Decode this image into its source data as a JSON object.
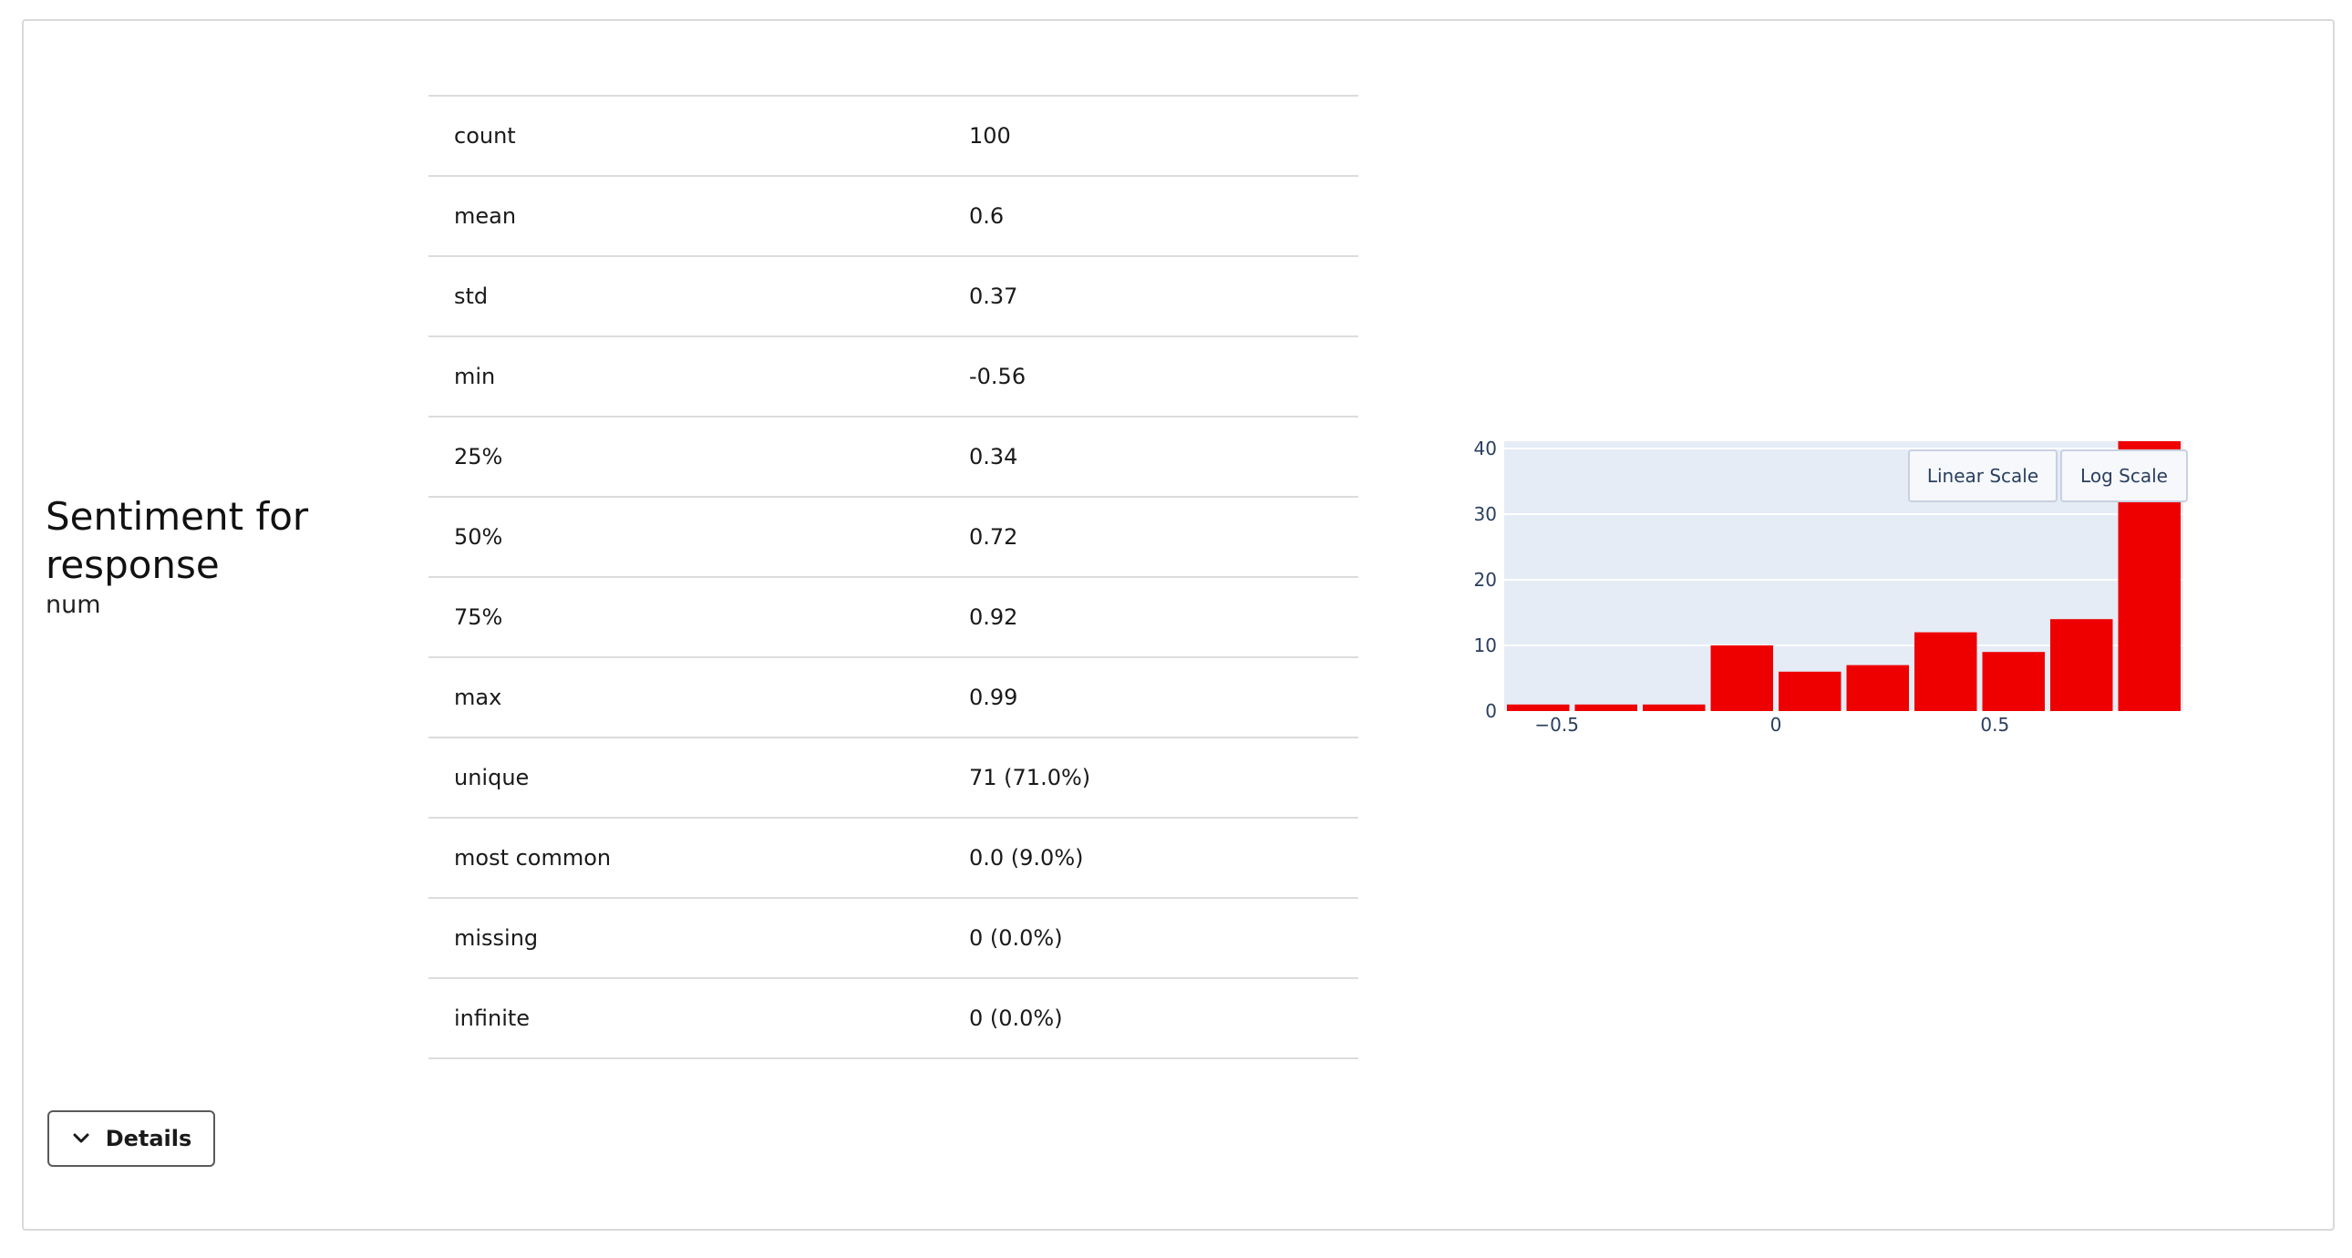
{
  "column": {
    "title": "Sentiment for response",
    "dtype": "num"
  },
  "stats": [
    {
      "label": "count",
      "value": "100"
    },
    {
      "label": "mean",
      "value": "0.6"
    },
    {
      "label": "std",
      "value": "0.37"
    },
    {
      "label": "min",
      "value": "-0.56"
    },
    {
      "label": "25%",
      "value": "0.34"
    },
    {
      "label": "50%",
      "value": "0.72"
    },
    {
      "label": "75%",
      "value": "0.92"
    },
    {
      "label": "max",
      "value": "0.99"
    },
    {
      "label": "unique",
      "value": "71 (71.0%)"
    },
    {
      "label": "most common",
      "value": "0.0 (9.0%)"
    },
    {
      "label": "missing",
      "value": "0 (0.0%)"
    },
    {
      "label": "infinite",
      "value": "0 (0.0%)"
    }
  ],
  "chart_controls": {
    "linear_label": "Linear Scale",
    "log_label": "Log Scale"
  },
  "details_button": {
    "label": "Details",
    "icon": "chevron-down-icon"
  },
  "chart_data": {
    "type": "bar",
    "x": [
      -0.6,
      -0.45,
      -0.3,
      -0.15,
      0.0,
      0.15,
      0.3,
      0.45,
      0.6,
      0.75,
      0.9
    ],
    "values": [
      1,
      1,
      1,
      10,
      6,
      7,
      12,
      9,
      14,
      42
    ],
    "bin_edges": [
      -0.62,
      -0.465,
      -0.31,
      -0.155,
      0.0,
      0.155,
      0.31,
      0.465,
      0.62,
      0.775,
      0.93
    ],
    "ylim": [
      0,
      40
    ],
    "y_ticks": [
      0,
      10,
      20,
      30,
      40
    ],
    "x_ticks": [
      {
        "value": -0.5,
        "label": "−0.5"
      },
      {
        "value": 0,
        "label": "0"
      },
      {
        "value": 0.5,
        "label": "0.5"
      }
    ],
    "xlim": [
      -0.62,
      0.93
    ],
    "bar_color": "#ee0000",
    "plot_bg": "#e5ecf6",
    "grid": true,
    "scale": "linear"
  }
}
